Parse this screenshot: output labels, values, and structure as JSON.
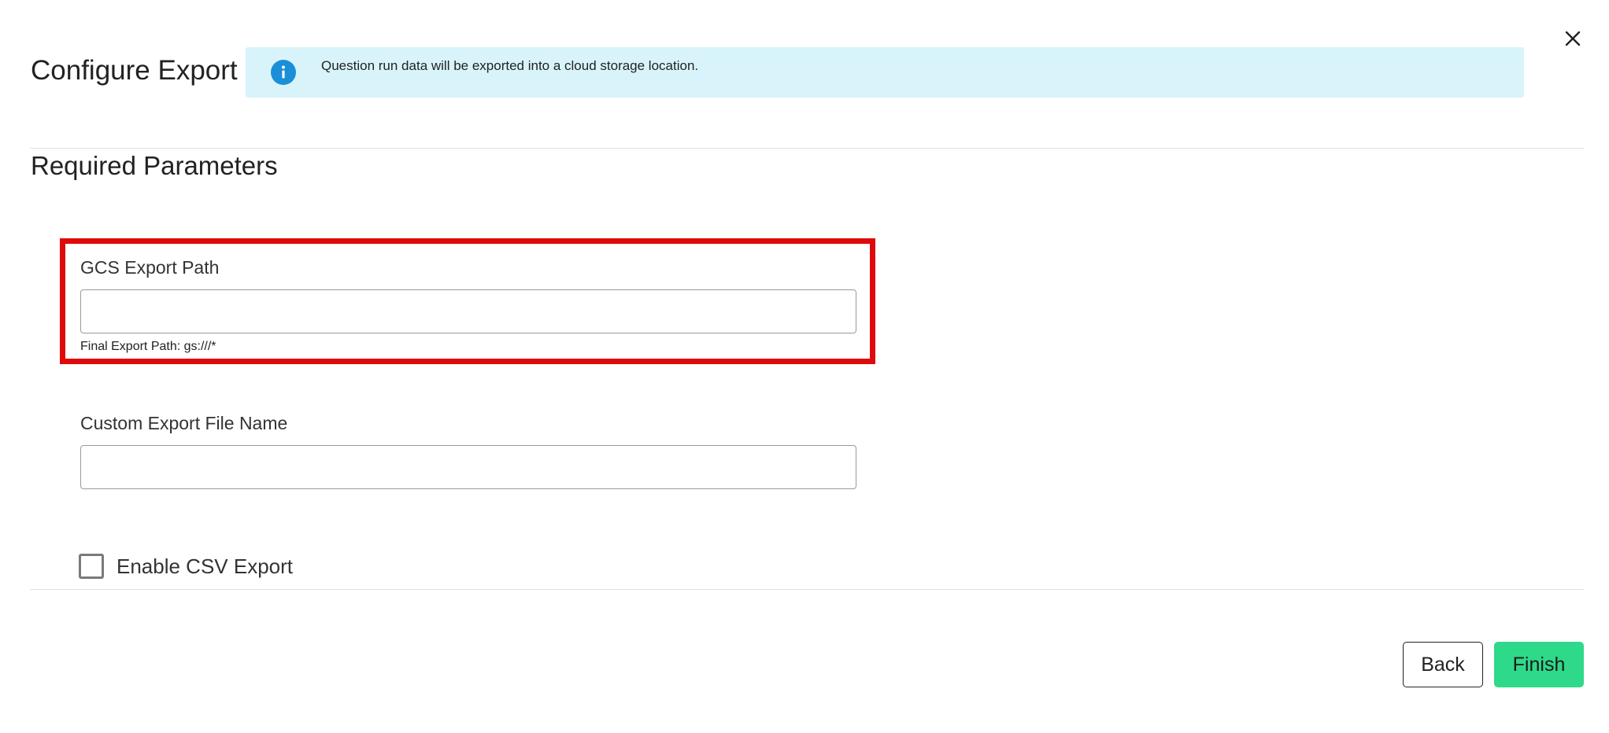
{
  "dialog": {
    "title": "Configure Export",
    "close_icon": "close-icon"
  },
  "info_banner": {
    "icon": "info-icon",
    "message": "Question run data will be exported into a cloud storage location.",
    "background_color": "#d8f4fa",
    "icon_color": "#1a8fd8"
  },
  "required_parameters": {
    "section_title": "Required Parameters",
    "gcs_export_path": {
      "label": "GCS Export Path",
      "value": "",
      "placeholder": "",
      "helper_text": "Final Export Path: gs:///*",
      "highlight_color": "#e00a0a"
    },
    "custom_file_name": {
      "label": "Custom Export File Name",
      "value": "",
      "placeholder": ""
    },
    "enable_csv_export": {
      "label": "Enable CSV Export",
      "checked": false
    }
  },
  "footer": {
    "back_label": "Back",
    "finish_label": "Finish",
    "finish_color": "#2fd98a"
  }
}
